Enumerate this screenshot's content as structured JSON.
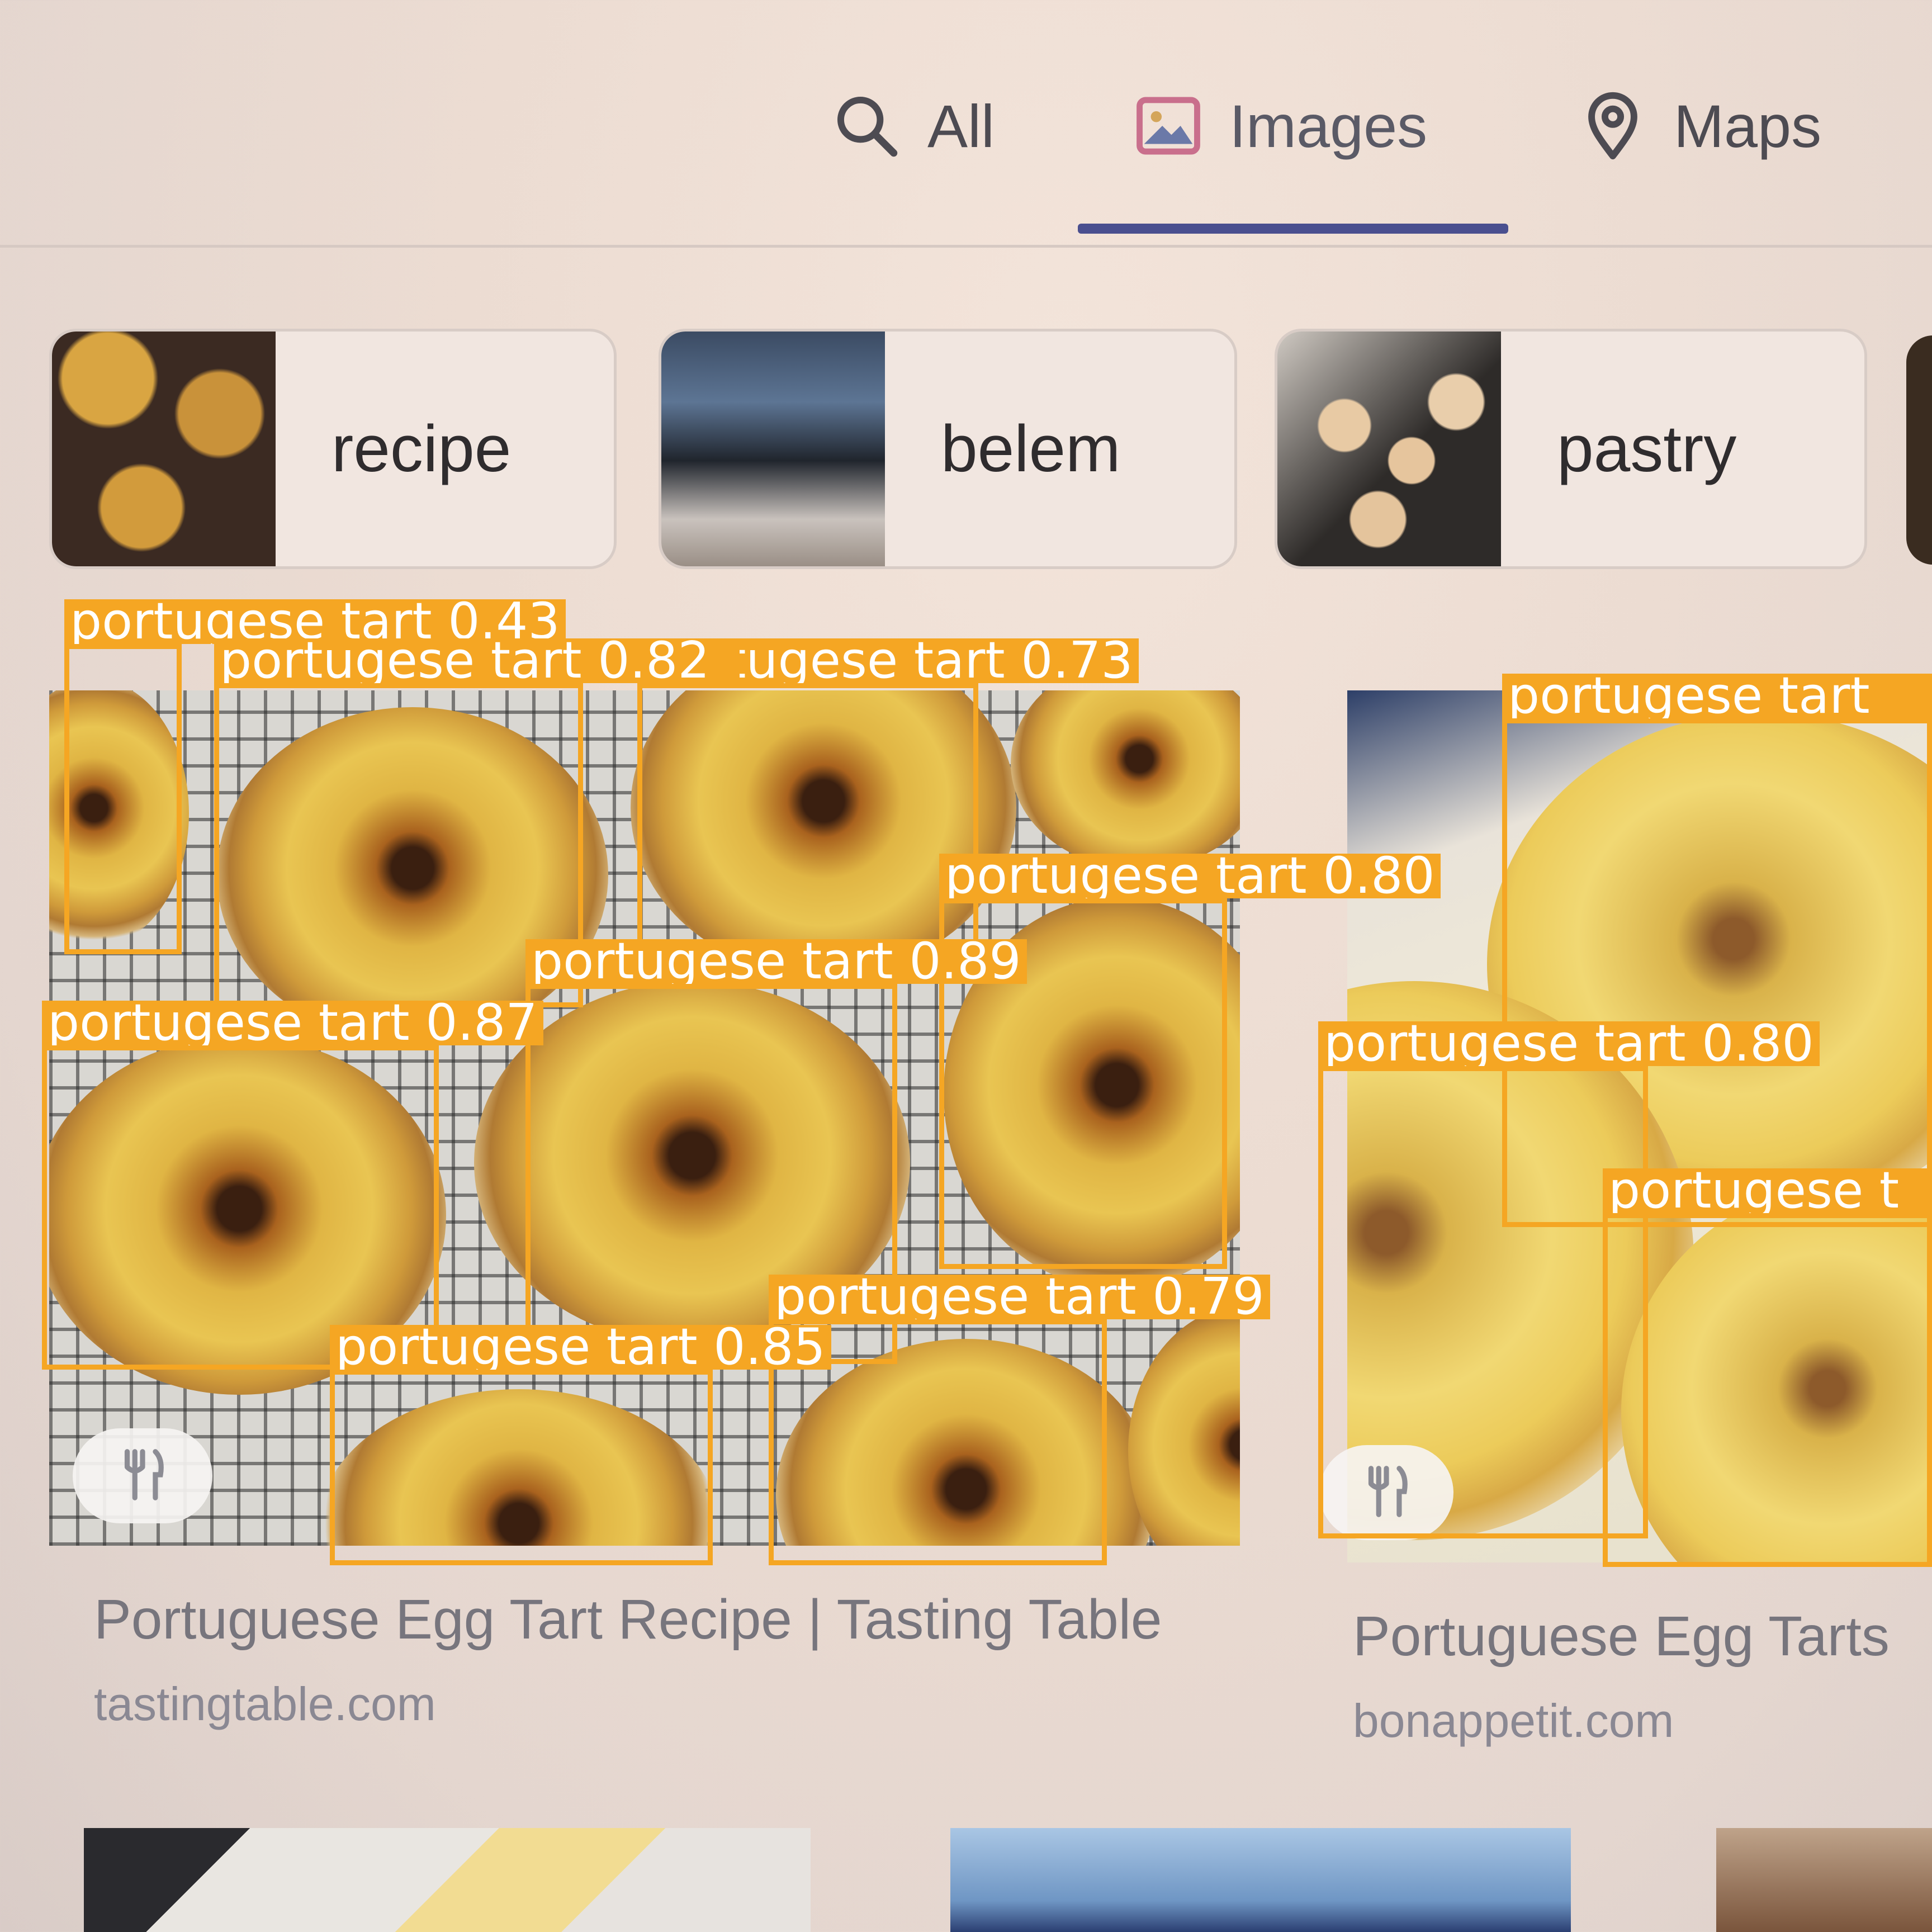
{
  "tabs": [
    {
      "label": "All",
      "icon": "search-icon",
      "active": false
    },
    {
      "label": "Images",
      "icon": "image-icon",
      "active": true
    },
    {
      "label": "Maps",
      "icon": "map-pin-icon",
      "active": false
    }
  ],
  "chips": [
    {
      "label": "recipe"
    },
    {
      "label": "belem"
    },
    {
      "label": "pastry"
    }
  ],
  "results": [
    {
      "title": "Portuguese Egg Tart Recipe | Tasting Table",
      "source": "tastingtable.com",
      "badge_icon": "fork-knife-icon"
    },
    {
      "title": "Portuguese Egg Tarts",
      "source": "bonappetit.com",
      "badge_icon": "fork-knife-icon"
    }
  ],
  "detections": [
    {
      "label": "portugese tart 0.43"
    },
    {
      "label": "portugese tart 0.82"
    },
    {
      "label": "portugese tart 0.73"
    },
    {
      "label": "portugese tart 0.80"
    },
    {
      "label": "portugese tart 0.89"
    },
    {
      "label": "portugese tart 0.87"
    },
    {
      "label": "portugese tart 0.85"
    },
    {
      "label": "portugese tart 0.79"
    },
    {
      "label": "portugese tart"
    },
    {
      "label": "portugese tart 0.80"
    },
    {
      "label": "portugese t"
    }
  ],
  "colors": {
    "detection": "#f5a623",
    "active_tab_indicator": "#4a4f8f",
    "detection_text": "#ffffff"
  }
}
